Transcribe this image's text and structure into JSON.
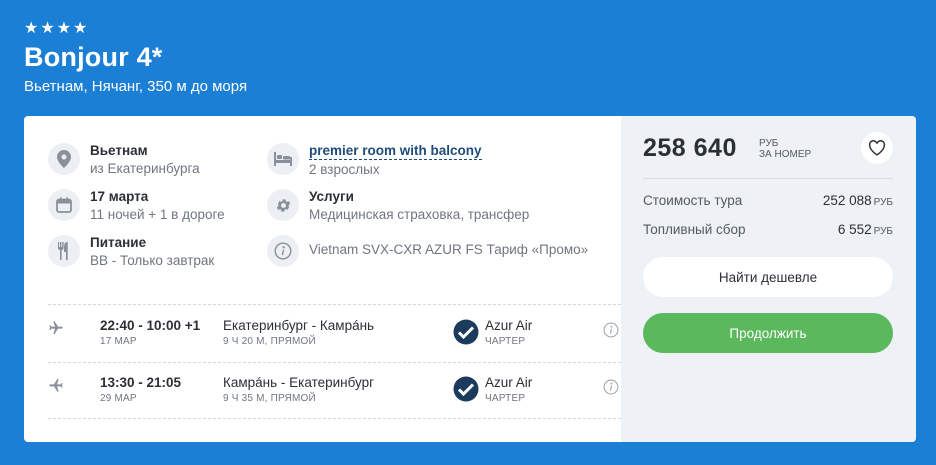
{
  "hotel": {
    "stars": 4,
    "star_glyph": "★",
    "title": "Bonjour 4*",
    "subtitle": "Вьетнам, Нячанг, 350 м до моря"
  },
  "info": {
    "destination_title": "Вьетнам",
    "destination_sub": "из Екатеринбурга",
    "date_title": "17 марта",
    "date_sub": "11 ночей + 1 в дороге",
    "meal_title": "Питание",
    "meal_sub": "BB - Только завтрак",
    "room_title": "premier room with balcony",
    "room_sub": "2 взрослых",
    "services_title": "Услуги",
    "services_sub": "Медицинская страховка, трансфер",
    "tariff": "Vietnam SVX-CXR AZUR FS Тариф «Промо»"
  },
  "flights": [
    {
      "time": "22:40 - 10:00 +1",
      "date": "17 МАР",
      "route": "Екатеринбург - Камрáнь",
      "duration": "9 Ч 20 М, ПРЯМОЙ",
      "airline": "Azur Air",
      "type": "ЧАРТЕР"
    },
    {
      "time": "13:30 - 21:05",
      "date": "29 МАР",
      "route": "Камрáнь - Екатеринбург",
      "duration": "9 Ч 35 М, ПРЯМОЙ",
      "airline": "Azur Air",
      "type": "ЧАРТЕР"
    }
  ],
  "price": {
    "total": "258 640",
    "currency_line1": "РУБ",
    "currency_line2": "ЗА НОМЕР",
    "tour_cost_label": "Стоимость тура",
    "tour_cost_value": "252 088",
    "fuel_label": "Топливный сбор",
    "fuel_value": "6 552",
    "currency_short": "РУБ"
  },
  "actions": {
    "cheaper_label": "Найти дешевле",
    "continue_label": "Продолжить"
  },
  "colors": {
    "background": "#1b7fd6",
    "continue_button": "#5cb85c",
    "link": "#1f4c7a"
  }
}
